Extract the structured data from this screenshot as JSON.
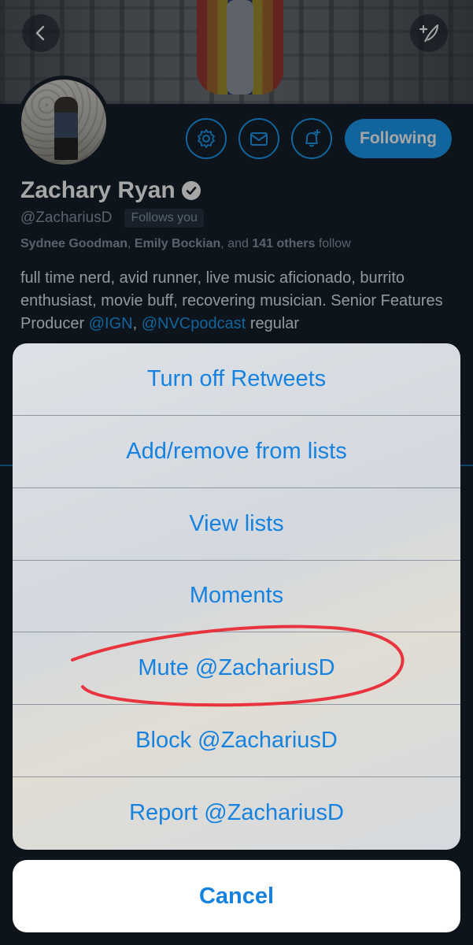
{
  "profile": {
    "display_name": "Zachary Ryan",
    "handle": "@ZachariusD",
    "follows_you_label": "Follows you",
    "known_followers": {
      "name1": "Sydnee Goodman",
      "separator1": ", ",
      "name2": "Emily Bockian",
      "separator2": ", and ",
      "others": "141 others",
      "suffix": " follow"
    },
    "bio": {
      "text": "full time nerd, avid runner, live music aficionado, burrito enthusiast, movie buff, recovering musician. Senior Features Producer ",
      "mention1": "@IGN",
      "separator": ", ",
      "mention2": "@NVCpodcast",
      "suffix": " regular"
    },
    "following_button_label": "Following"
  },
  "icons": {
    "back": "chevron-left-icon",
    "compose": "compose-tweet-icon",
    "settings": "gear-icon",
    "message": "envelope-icon",
    "notify": "bell-plus-icon",
    "verified": "verified-badge-icon"
  },
  "action_sheet": {
    "items": [
      "Turn off Retweets",
      "Add/remove from lists",
      "View lists",
      "Moments",
      "Mute @ZachariusD",
      "Block @ZachariusD",
      "Report @ZachariusD"
    ],
    "cancel_label": "Cancel"
  },
  "colors": {
    "accent": "#1d9bf0",
    "sheet_text": "#1682e0",
    "annotation": "#e8343f",
    "background": "#15202b"
  }
}
